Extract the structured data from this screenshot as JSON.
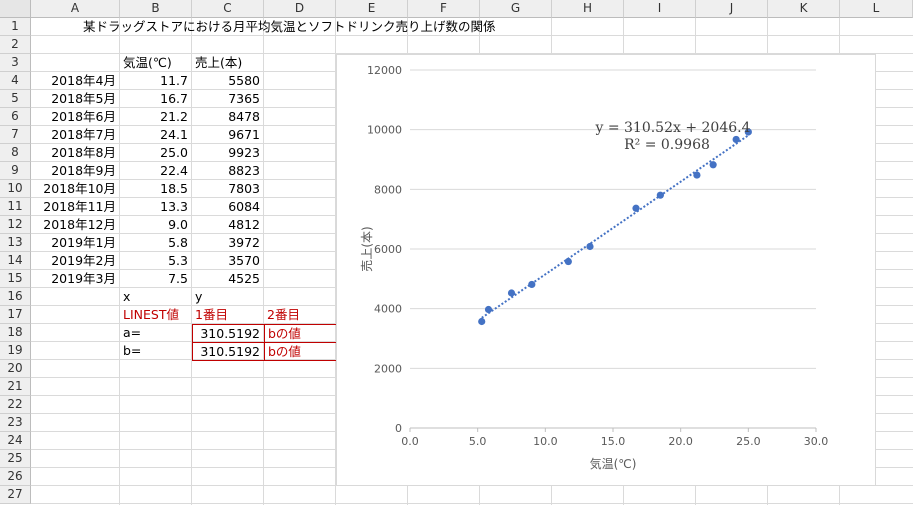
{
  "columns": [
    "A",
    "B",
    "C",
    "D",
    "E",
    "F",
    "G",
    "H",
    "I",
    "J",
    "K",
    "L"
  ],
  "rows": [
    "1",
    "2",
    "3",
    "4",
    "5",
    "6",
    "7",
    "8",
    "9",
    "10",
    "11",
    "12",
    "13",
    "14",
    "15",
    "16",
    "17",
    "18",
    "19",
    "20",
    "21",
    "22",
    "23",
    "24",
    "25",
    "26",
    "27"
  ],
  "title": "某ドラッグストアにおける月平均気温とソフトドリンク売り上げ数の関係",
  "header": {
    "temp": "気温(℃)",
    "sales": "売上(本)"
  },
  "table": [
    {
      "month": "2018年4月",
      "temp": "11.7",
      "sales": "5580"
    },
    {
      "month": "2018年5月",
      "temp": "16.7",
      "sales": "7365"
    },
    {
      "month": "2018年6月",
      "temp": "21.2",
      "sales": "8478"
    },
    {
      "month": "2018年7月",
      "temp": "24.1",
      "sales": "9671"
    },
    {
      "month": "2018年8月",
      "temp": "25.0",
      "sales": "9923"
    },
    {
      "month": "2018年9月",
      "temp": "22.4",
      "sales": "8823"
    },
    {
      "month": "2018年10月",
      "temp": "18.5",
      "sales": "7803"
    },
    {
      "month": "2018年11月",
      "temp": "13.3",
      "sales": "6084"
    },
    {
      "month": "2018年12月",
      "temp": "9.0",
      "sales": "4812"
    },
    {
      "month": "2019年1月",
      "temp": "5.8",
      "sales": "3972"
    },
    {
      "month": "2019年2月",
      "temp": "5.3",
      "sales": "3570"
    },
    {
      "month": "2019年3月",
      "temp": "7.5",
      "sales": "4525"
    }
  ],
  "xy": {
    "x": "x",
    "y": "y"
  },
  "linest": {
    "label": "LINEST値",
    "first": "1番目",
    "second": "2番目",
    "a_label": "a=",
    "b_label": "b=",
    "a_value": "310.5192",
    "b_value": "310.5192",
    "b_note": "bの値",
    "b_note2": "bの値"
  },
  "colors": {
    "marker": "#4472c4",
    "red": "#c00000"
  },
  "chart_data": {
    "type": "scatter",
    "xlabel": "気温(℃)",
    "ylabel": "売上(本)",
    "xlim": [
      0,
      30
    ],
    "ylim": [
      0,
      12000
    ],
    "xticks": [
      "0.0",
      "5.0",
      "10.0",
      "15.0",
      "20.0",
      "25.0",
      "30.0"
    ],
    "yticks": [
      "0",
      "2000",
      "4000",
      "6000",
      "8000",
      "10000",
      "12000"
    ],
    "x": [
      11.7,
      16.7,
      21.2,
      24.1,
      25.0,
      22.4,
      18.5,
      13.3,
      9.0,
      5.8,
      5.3,
      7.5
    ],
    "y": [
      5580,
      7365,
      8478,
      9671,
      9923,
      8823,
      7803,
      6084,
      4812,
      3972,
      3570,
      4525
    ],
    "trendline": {
      "slope": 310.52,
      "intercept": 2046.4,
      "x_from": 5.3,
      "x_to": 25.0
    },
    "equation": "y = 310.52x + 2046.4",
    "r2": "R² = 0.9968",
    "grid": true,
    "legend": "none"
  }
}
